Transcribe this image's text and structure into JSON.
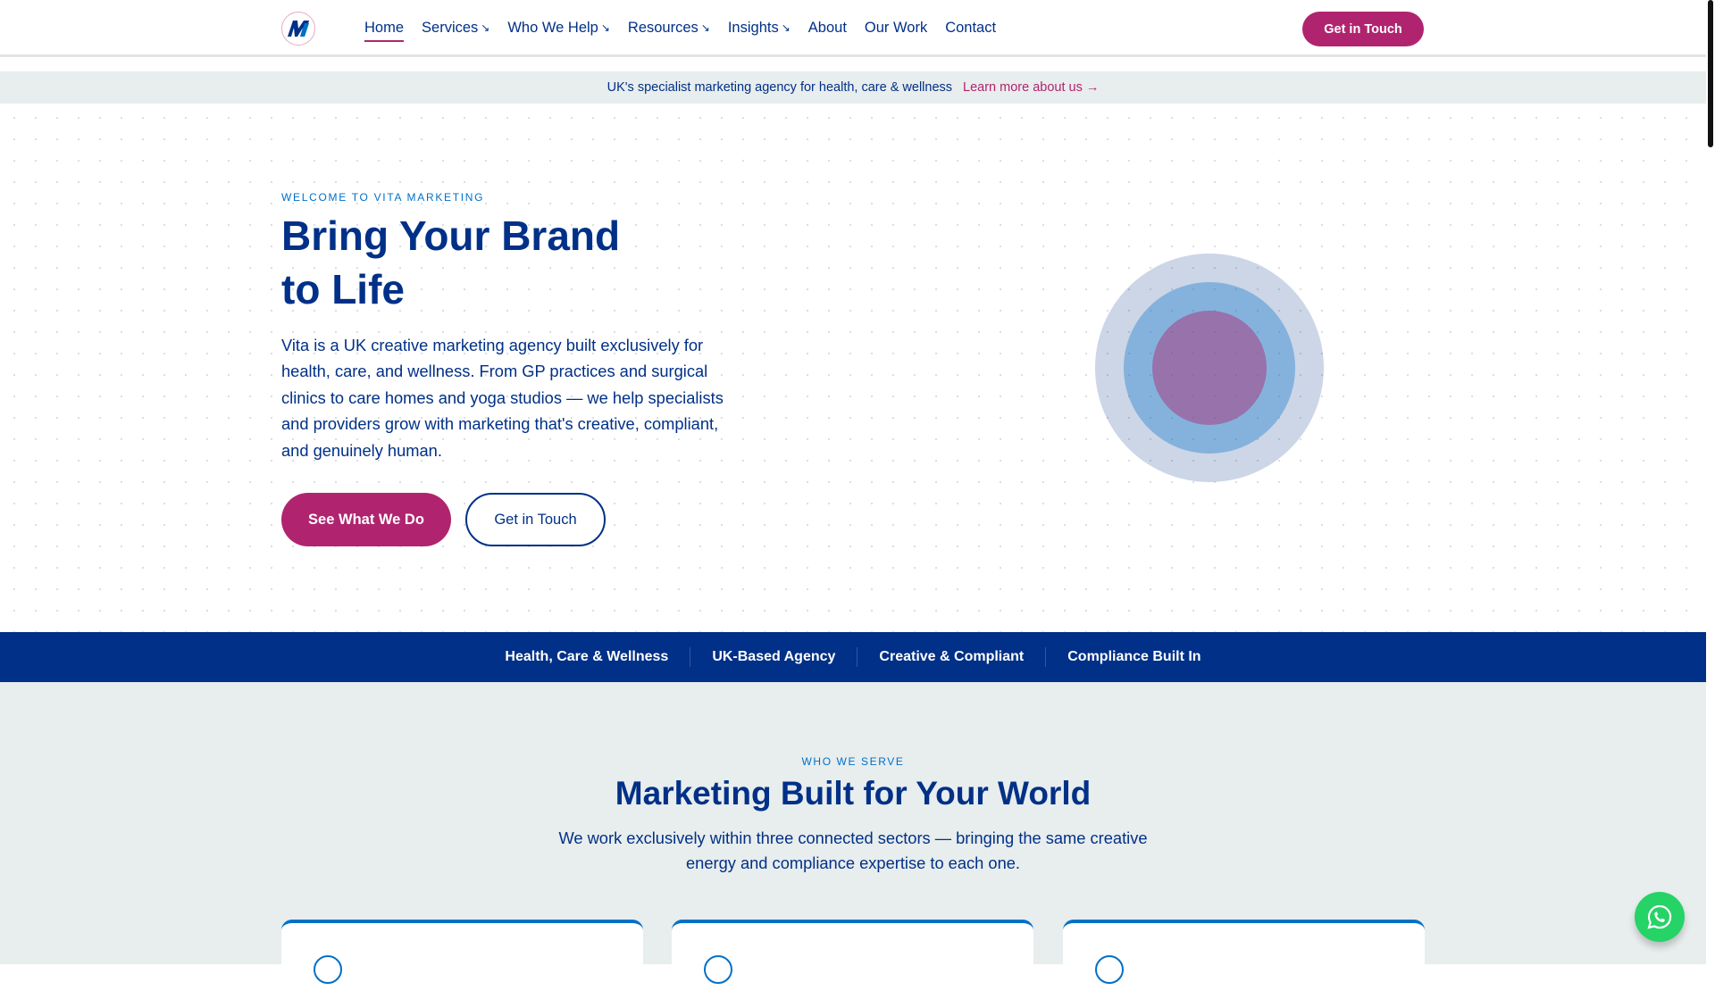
{
  "nav": {
    "logo_letter": "M",
    "links": [
      {
        "label": "Home",
        "arrow": ""
      },
      {
        "label": "Services",
        "arrow": "↘"
      },
      {
        "label": "Who We Help",
        "arrow": "↘"
      },
      {
        "label": "Resources",
        "arrow": "↘"
      },
      {
        "label": "Insights",
        "arrow": "↘"
      },
      {
        "label": "About",
        "arrow": ""
      },
      {
        "label": "Our Work",
        "arrow": ""
      },
      {
        "label": "Contact",
        "arrow": ""
      }
    ],
    "cta": "Get in Touch"
  },
  "banner": {
    "text": "UK's specialist marketing agency for health, care & wellness",
    "link": "Learn more about us →"
  },
  "hero": {
    "eyebrow": "WELCOME TO VITA MARKETING",
    "title_line1": "Bring Your Brand",
    "title_line2": "to Life",
    "description": "Vita is a UK creative marketing agency built exclusively for health, care, and wellness. From GP practices and surgical clinics to care homes and yoga studios — we help specialists and providers grow with marketing that's creative, compliant, and genuinely human.",
    "primary_button": "See What We Do",
    "secondary_button": "Get in Touch"
  },
  "strip": [
    "Health, Care & Wellness",
    "UK-Based Agency",
    "Creative & Compliant",
    "Compliance Built In"
  ],
  "serve": {
    "eyebrow": "WHO WE SERVE",
    "title": "Marketing Built for Your World",
    "description": "We work exclusively within three connected sectors — bringing the same creative energy and compliance expertise to each one."
  },
  "colors": {
    "navy": "#003087",
    "magenta": "#b0246f",
    "accent": "#0070c9",
    "whatsapp": "#25d366"
  }
}
